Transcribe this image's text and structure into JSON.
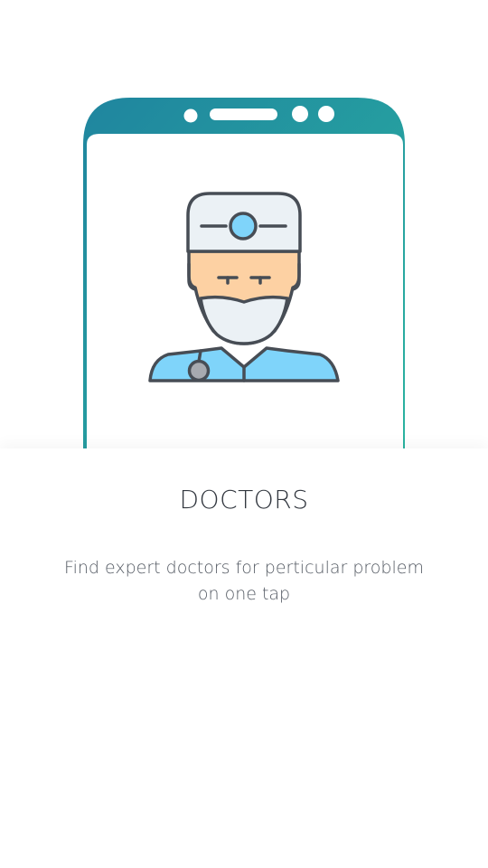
{
  "onboarding": {
    "title": "DOCTORS",
    "description": "Find expert doctors for perticular problem on one tap"
  },
  "illustration": {
    "device": "smartphone-frame",
    "icon": "doctor-icon",
    "accent_gradient": [
      "#1f879e",
      "#2ab0a0"
    ],
    "face_color": "#fdd1a3",
    "uniform_color": "#7fd4fa",
    "cap_color": "#ebf1f5",
    "stroke_color": "#474d55"
  }
}
